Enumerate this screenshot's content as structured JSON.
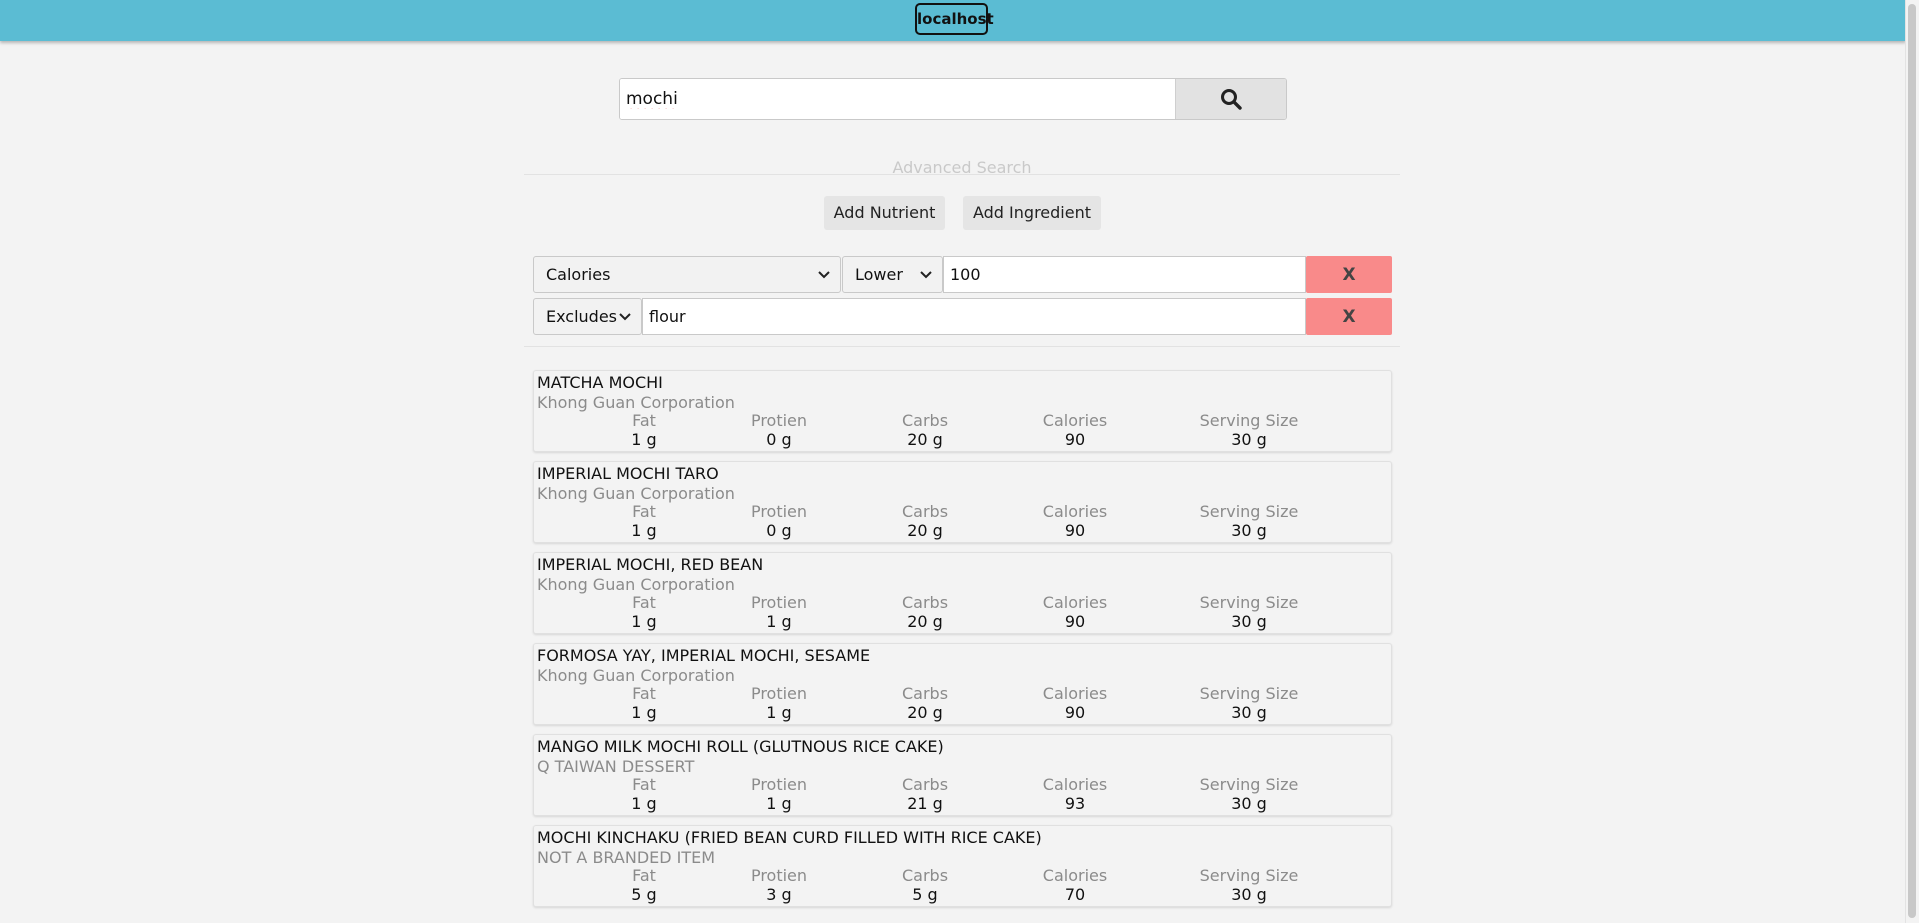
{
  "header": {
    "host": "localhost"
  },
  "search": {
    "query": "mochi",
    "icon": "search-icon"
  },
  "advanced": {
    "label": "Advanced Search",
    "add_nutrient": "Add Nutrient",
    "add_ingredient": "Add Ingredient"
  },
  "filters": {
    "nutrient": {
      "nutrient": "Calories",
      "bound": "Lower",
      "value": "100",
      "remove": "X"
    },
    "ingredient": {
      "mode": "Excludes",
      "value": "flour",
      "remove": "X"
    }
  },
  "stat_labels": {
    "fat": "Fat",
    "protein": "Protien",
    "carbs": "Carbs",
    "calories": "Calories",
    "serving": "Serving Size"
  },
  "results": [
    {
      "name": "MATCHA MOCHI",
      "brand": "Khong Guan Corporation",
      "fat": "1 g",
      "protein": "0 g",
      "carbs": "20 g",
      "calories": "90",
      "serving": "30 g"
    },
    {
      "name": "IMPERIAL MOCHI TARO",
      "brand": "Khong Guan Corporation",
      "fat": "1 g",
      "protein": "0 g",
      "carbs": "20 g",
      "calories": "90",
      "serving": "30 g"
    },
    {
      "name": "IMPERIAL MOCHI, RED BEAN",
      "brand": "Khong Guan Corporation",
      "fat": "1 g",
      "protein": "1 g",
      "carbs": "20 g",
      "calories": "90",
      "serving": "30 g"
    },
    {
      "name": "FORMOSA YAY, IMPERIAL MOCHI, SESAME",
      "brand": "Khong Guan Corporation",
      "fat": "1 g",
      "protein": "1 g",
      "carbs": "20 g",
      "calories": "90",
      "serving": "30 g"
    },
    {
      "name": "MANGO MILK MOCHI ROLL (GLUTNOUS RICE CAKE)",
      "brand": "Q TAIWAN DESSERT",
      "fat": "1 g",
      "protein": "1 g",
      "carbs": "21 g",
      "calories": "93",
      "serving": "30 g"
    },
    {
      "name": "MOCHI KINCHAKU (FRIED BEAN CURD FILLED WITH RICE CAKE)",
      "brand": "NOT A BRANDED ITEM",
      "fat": "5 g",
      "protein": "3 g",
      "carbs": "5 g",
      "calories": "70",
      "serving": "30 g"
    }
  ]
}
